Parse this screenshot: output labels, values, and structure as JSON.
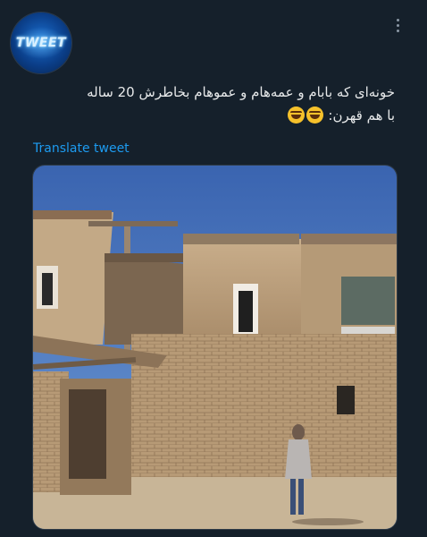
{
  "tweet": {
    "line1": "خونه‌ای که بابام و عمه‌هام و عموهام بخاطرش 20 ساله",
    "line2": "با هم قهرن:",
    "emoji_names": [
      "face-with-tears-of-joy",
      "face-with-tears-of-joy"
    ],
    "translate_label": "Translate tweet"
  },
  "author": {
    "avatar_text": "TWEET",
    "avatar_icon": "avatar-logo"
  },
  "media": {
    "description_icon": "photo-old-mudbrick-house"
  },
  "colors": {
    "background": "#15202b",
    "text": "#e7e9ea",
    "link": "#1d9bf0",
    "sky": "#3f6fb8"
  }
}
